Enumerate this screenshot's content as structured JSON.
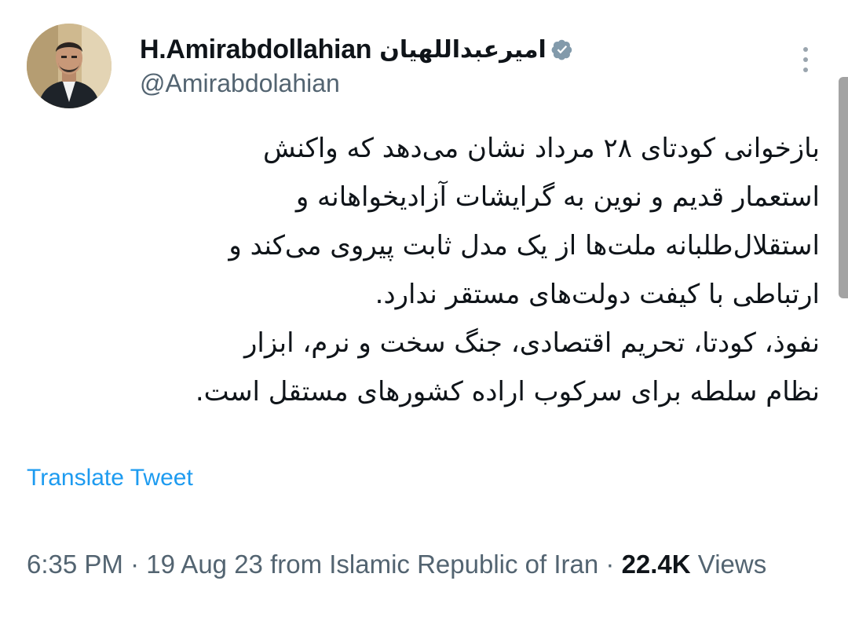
{
  "header": {
    "display_name": "H.Amirabdollahian",
    "display_name_persian": "امیرعبداللهیان",
    "handle": "@Amirabdolahian",
    "verified_icon": "verified-badge-icon",
    "more_icon": "more-vertical-icon"
  },
  "tweet": {
    "lines": [
      "بازخوانی کودتای ۲۸ مرداد نشان می‌دهد که واکنش",
      "استعمار قدیم و نوین به گرایشات آزادیخواهانه و",
      "استقلال‌طلبانه ملت‌ها از یک مدل ثابت پیروی می‌کند و",
      "ارتباطی با کیفت دولت‌های مستقر ندارد.",
      "نفوذ، کودتا، تحریم اقتصادی، جنگ سخت و نرم، ابزار",
      "نظام سلطه برای سرکوب اراده کشورهای  مستقل است."
    ]
  },
  "translate_label": "Translate Tweet",
  "meta": {
    "time": "6:35 PM",
    "date": "19 Aug 23",
    "source": "from Islamic Republic of Iran",
    "separator": "·",
    "views_count": "22.4K",
    "views_label": "Views"
  },
  "colors": {
    "accent": "#1d9bf0",
    "secondary_text": "#536471",
    "primary_text": "#0f1419",
    "verified": "#829aab"
  }
}
